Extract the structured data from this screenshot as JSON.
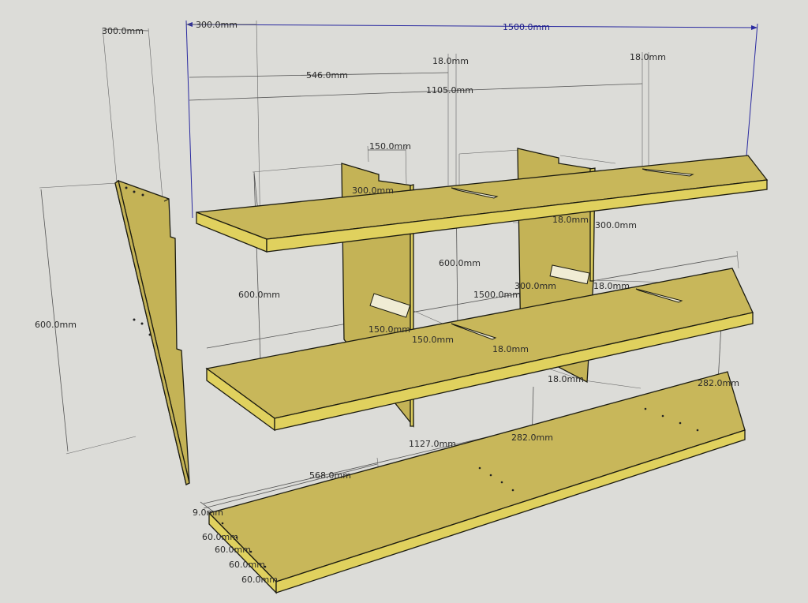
{
  "drawing": {
    "dimensions": {
      "overall_width": "1500.0mm",
      "top_300": "300.0mm",
      "side_300": "300.0mm",
      "d546": "546.0mm",
      "d1105": "1105.0mm",
      "t18_a": "18.0mm",
      "t18_b": "18.0mm",
      "s150_top": "150.0mm",
      "u300": "300.0mm",
      "side_600": "600.0mm",
      "left_600": "600.0mm",
      "mid_600": "600.0mm",
      "t18_c": "18.0mm",
      "r300": "300.0mm",
      "c300": "300.0mm",
      "t18_d": "18.0mm",
      "mid_1500": "1500.0mm",
      "s150_a": "150.0mm",
      "s150_b": "150.0mm",
      "t18_e": "18.0mm",
      "t18_f": "18.0mm",
      "r282": "282.0mm",
      "c282": "282.0mm",
      "d1127": "1127.0mm",
      "d568": "568.0mm",
      "d9": "9.0mm",
      "h60_a": "60.0mm",
      "h60_b": "60.0mm",
      "h60_c": "60.0mm",
      "h60_d": "60.0mm"
    }
  }
}
